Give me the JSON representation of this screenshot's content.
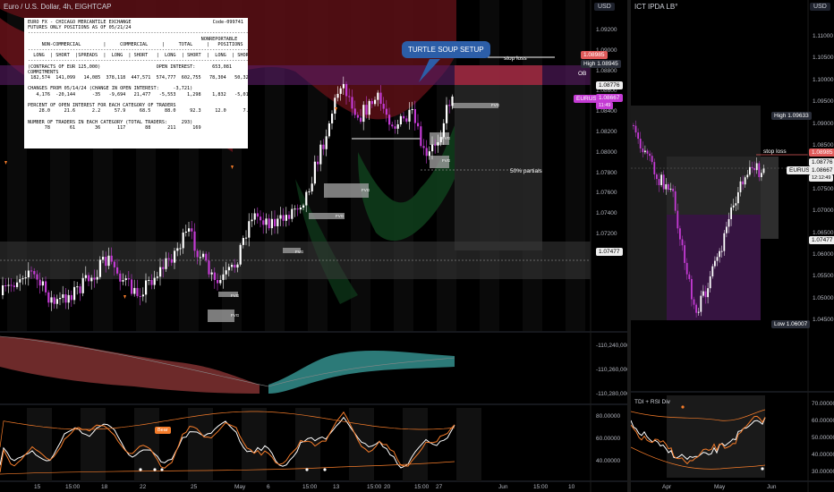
{
  "left_chart": {
    "title": "Euro / U.S. Dollar, 4h, EIGHTCAP",
    "currency": "USD",
    "price_axis": [
      "1.09200",
      "1.09000",
      "1.08800",
      "1.08600",
      "1.08400",
      "1.08200",
      "1.08000",
      "1.07800",
      "1.07600",
      "1.07400",
      "1.07200",
      "1.07000"
    ],
    "badges": {
      "top": "1.08985",
      "high_label": "High",
      "high": "1.08945",
      "ob": "OB",
      "mid": "1.08776",
      "symbol": "EURUSD",
      "symbol_price": "1.08667",
      "symbol_time": "11:49",
      "level": "1.07477"
    },
    "indicator_axis": [
      "-110,240,000",
      "-110,260,000",
      "-110,280,000"
    ],
    "rsi_axis": [
      "80.00000",
      "60.00000",
      "40.00000"
    ],
    "time_axis": [
      "15",
      "15:00",
      "18",
      "22",
      "25",
      "May",
      "6",
      "15:00",
      "13",
      "15:00",
      "20",
      "15:00",
      "27",
      "Jun",
      "15:00",
      "10"
    ],
    "callout": "TURTLE SOUP SETUP",
    "stop_loss": "stop loss",
    "partials": "50% partials",
    "fvg_label": "FVG",
    "cot": {
      "header_left": "EURO FX - CHICAGO MERCANTILE EXCHANGE",
      "header_right": "Code-099741",
      "positions_as_of": "FUTURES ONLY POSITIONS AS OF 05/21/24",
      "body": "--------------------------------------------------------------------------------\n                                                              NONREPORTABLE\n     NON-COMMERCIAL        |     COMMERCIAL     |     TOTAL     |   POSITIONS\n--------------------------------------------------------------------------------\n  LONG  | SHORT  |SPREADS  |  LONG  | SHORT   |  LONG  | SHORT  |  LONG  | SHORT\n--------------------------------------------------------------------------------\n(CONTRACTS OF EUR 125,000)                    OPEN INTEREST:      653,081\nCOMMITMENTS\n 182,574  141,099   14,085  378,118  447,571  574,777  602,755   78,304   50,326\n\nCHANGES FROM 05/14/24 (CHANGE IN OPEN INTEREST:     -3,721)\n   4,176  -20,144      -35   -9,694   21,477   -5,553    1,298    1,832   -5,019\n\nPERCENT OF OPEN INTEREST FOR EACH CATEGORY OF TRADERS\n    28.0     21.6      2.2     57.9     68.5     88.0     92.3     12.0      7.7\n\nNUMBER OF TRADERS IN EACH CATEGORY (TOTAL TRADERS:     293)\n      78       61       36      117       88      211      169"
    },
    "rsi_badge": "Bear"
  },
  "right_chart": {
    "title": "ICT IPDA LB°",
    "currency": "USD",
    "price_axis": [
      "1.11000",
      "1.10500",
      "1.10000",
      "1.09500",
      "1.09000",
      "1.08500",
      "1.08000",
      "1.07500",
      "1.07000",
      "1.06500",
      "1.06000",
      "1.05500",
      "1.05000",
      "1.04500"
    ],
    "badges": {
      "high_label": "High",
      "high": "1.09633",
      "top": "1.08985",
      "mid": "1.08776",
      "symbol": "EURUSD",
      "symbol_price": "1.08667",
      "symbol_time": "12:12:49",
      "level": "1.07477",
      "low_label": "Low",
      "low": "1.06007"
    },
    "stop_loss": "stop loss",
    "indicator_title": "TDI + RSI Div",
    "rsi_axis": [
      "70.00000",
      "60.00000",
      "50.00000",
      "40.00000",
      "30.00000"
    ],
    "time_axis": [
      "Apr",
      "May",
      "Jun"
    ]
  },
  "colors": {
    "bull": "#ffffff",
    "bear": "#c43bd4",
    "red_zone": "#8b1a24",
    "green_zone": "#1a5a2a",
    "callout": "#2c5ea8",
    "orange": "#f57c2a"
  }
}
